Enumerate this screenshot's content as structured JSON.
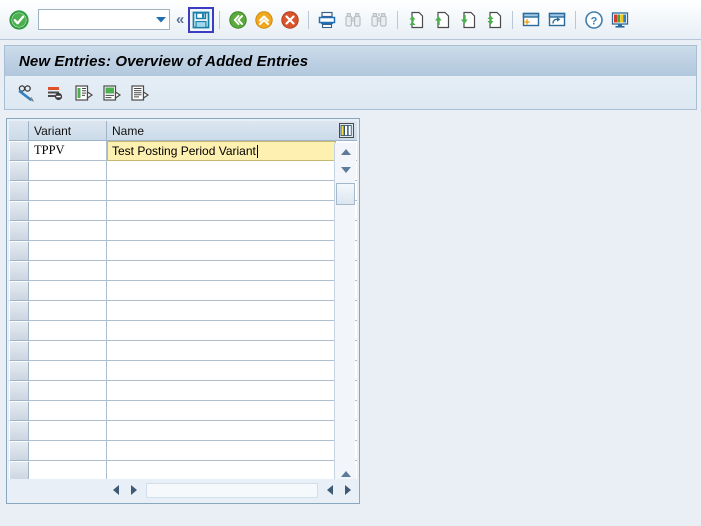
{
  "toolbar": {
    "status_icon": "green-check-icon",
    "command_field": {
      "value": "",
      "placeholder": ""
    },
    "back_chevron_label": "«",
    "items": [
      {
        "name": "enter-button",
        "icon": "green-check-circle-icon",
        "label": "Enter"
      },
      {
        "name": "save-button",
        "icon": "floppy-disk-icon",
        "label": "Save",
        "selected": true
      },
      {
        "name": "back-button",
        "icon": "green-back-arrow-icon",
        "label": "Back"
      },
      {
        "name": "exit-button",
        "icon": "orange-up-arrow-icon",
        "label": "Exit"
      },
      {
        "name": "cancel-button",
        "icon": "red-cross-circle-icon",
        "label": "Cancel"
      },
      {
        "name": "print-button",
        "icon": "printer-icon",
        "label": "Print"
      },
      {
        "name": "find-button",
        "icon": "binoculars-icon",
        "label": "Find"
      },
      {
        "name": "find-next-button",
        "icon": "binoculars-plus-icon",
        "label": "Find Next"
      },
      {
        "name": "first-page-button",
        "icon": "first-page-icon",
        "label": "First Page"
      },
      {
        "name": "previous-page-button",
        "icon": "previous-page-icon",
        "label": "Previous Page"
      },
      {
        "name": "next-page-button",
        "icon": "next-page-icon",
        "label": "Next Page"
      },
      {
        "name": "last-page-button",
        "icon": "last-page-icon",
        "label": "Last Page"
      },
      {
        "name": "create-session-button",
        "icon": "create-session-icon",
        "label": "Create New Session"
      },
      {
        "name": "create-shortcut-button",
        "icon": "create-shortcut-icon",
        "label": "Create Shortcut"
      },
      {
        "name": "help-button",
        "icon": "question-mark-icon",
        "label": "Help"
      },
      {
        "name": "customize-layout-button",
        "icon": "monitor-color-icon",
        "label": "Customize Local Layout"
      }
    ]
  },
  "title": "New Entries: Overview of Added Entries",
  "subtoolbar": {
    "items": [
      {
        "name": "display-change-button",
        "icon": "glasses-pencil-icon",
        "label": "Display/Change"
      },
      {
        "name": "new-entries-button",
        "icon": "new-entries-icon",
        "label": "New Entries"
      },
      {
        "name": "copy-as-button",
        "icon": "copy-as-icon",
        "label": "Copy As..."
      },
      {
        "name": "delete-button",
        "icon": "delete-entry-icon",
        "label": "Delete"
      },
      {
        "name": "undo-change-button",
        "icon": "undo-change-icon",
        "label": "Undo Change"
      }
    ]
  },
  "grid": {
    "config_icon": "column-settings-icon",
    "columns": [
      {
        "key": "variant",
        "label": "Variant"
      },
      {
        "key": "name",
        "label": "Name"
      }
    ],
    "rows": [
      {
        "variant": "TPPV",
        "name": "Test Posting Period Variant",
        "focused_field": "name",
        "caret": true
      },
      {
        "variant": "",
        "name": ""
      },
      {
        "variant": "",
        "name": ""
      },
      {
        "variant": "",
        "name": ""
      },
      {
        "variant": "",
        "name": ""
      },
      {
        "variant": "",
        "name": ""
      },
      {
        "variant": "",
        "name": ""
      },
      {
        "variant": "",
        "name": ""
      },
      {
        "variant": "",
        "name": ""
      },
      {
        "variant": "",
        "name": ""
      },
      {
        "variant": "",
        "name": ""
      },
      {
        "variant": "",
        "name": ""
      },
      {
        "variant": "",
        "name": ""
      },
      {
        "variant": "",
        "name": ""
      },
      {
        "variant": "",
        "name": ""
      },
      {
        "variant": "",
        "name": ""
      },
      {
        "variant": "",
        "name": ""
      }
    ],
    "vertical_scrollbar": {
      "up_arrow": "scroll-up-arrow",
      "down_arrow": "scroll-down-arrow",
      "page_up_arrow": "page-up-arrow",
      "page_down_arrow": "page-down-arrow"
    },
    "horizontal_scrollbar": {
      "left_arrow": "scroll-left-arrow",
      "right_arrow": "scroll-right-arrow"
    }
  },
  "colors": {
    "accent": "#3b3bc4",
    "title_bar": "#bdd0e3",
    "focus_field": "#fdf0b0",
    "focus_border": "#e02020",
    "page_bg": "#eaeff5"
  }
}
